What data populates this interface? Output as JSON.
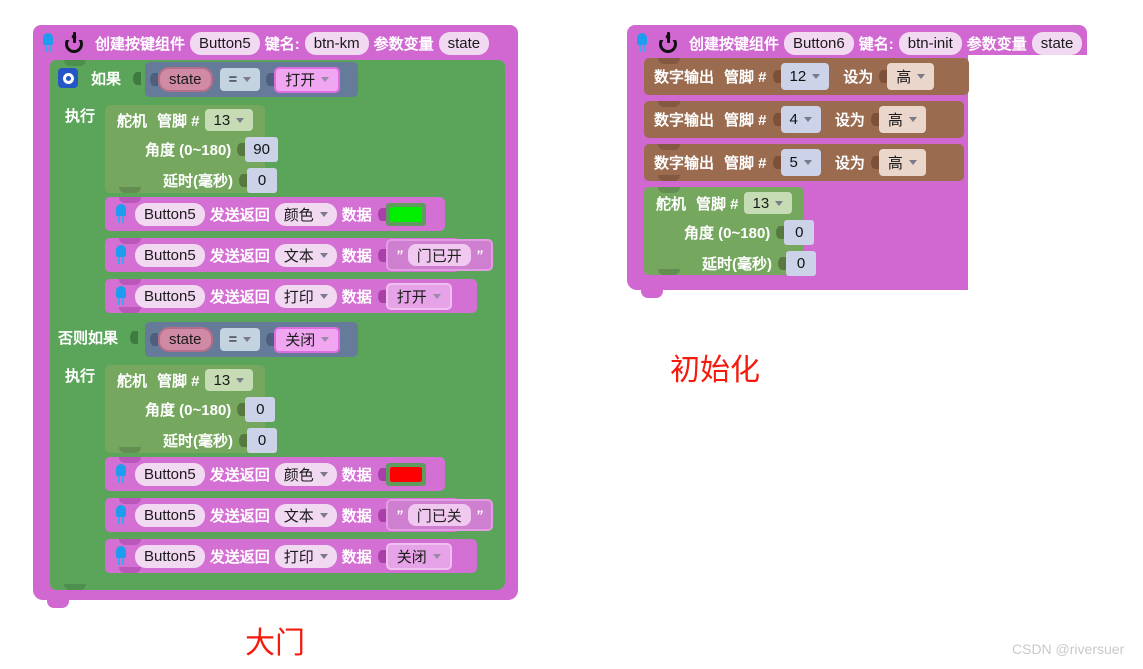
{
  "meta": {
    "watermark": "CSDN @riversuer",
    "captions": {
      "left": "大门",
      "right": "初始化"
    },
    "colors": {
      "event_purple": "#d168d1",
      "control_green": "#5ba55b",
      "servo_olive": "#76a75f",
      "send_magenta": "#d46fd4",
      "logic_blue": "#667a99",
      "digital_brown": "#9a6b4f",
      "caption_red": "#f41b0c",
      "swatch_open": "#00ee00",
      "swatch_close": "#ff0000"
    }
  },
  "left_program": {
    "hat": {
      "icon": "power-icon",
      "led_icon": "led-icon",
      "label": "创建按键组件",
      "component": "Button5",
      "key_label": "键名:",
      "key_value": "btn-km",
      "param_label": "参数变量",
      "param_value": "state"
    },
    "if_block": {
      "gear_icon": "gear-icon",
      "if_label": "如果",
      "do_label": "执行",
      "elseif_label": "否则如果",
      "do_label2": "执行"
    },
    "cond1": {
      "variable": "state",
      "operator": "=",
      "value": "打开"
    },
    "cond2": {
      "variable": "state",
      "operator": "=",
      "value": "关闭"
    },
    "servo1": {
      "title": "舵机",
      "pin_label": "管脚 #",
      "pin": "13",
      "angle_label": "角度 (0~180)",
      "angle": "90",
      "delay_label": "延时(毫秒)",
      "delay": "0"
    },
    "servo2": {
      "title": "舵机",
      "pin_label": "管脚 #",
      "pin": "13",
      "angle_label": "角度 (0~180)",
      "angle": "0",
      "delay_label": "延时(毫秒)",
      "delay": "0"
    },
    "branch_true": [
      {
        "component": "Button5",
        "action": "发送返回",
        "kind": "颜色",
        "data_label": "数据",
        "value_type": "color",
        "value": "#00ee00"
      },
      {
        "component": "Button5",
        "action": "发送返回",
        "kind": "文本",
        "data_label": "数据",
        "value_type": "text",
        "value": "门已开"
      },
      {
        "component": "Button5",
        "action": "发送返回",
        "kind": "打印",
        "data_label": "数据",
        "value_type": "dropdown",
        "value": "打开"
      }
    ],
    "branch_false": [
      {
        "component": "Button5",
        "action": "发送返回",
        "kind": "颜色",
        "data_label": "数据",
        "value_type": "color",
        "value": "#ff0000"
      },
      {
        "component": "Button5",
        "action": "发送返回",
        "kind": "文本",
        "data_label": "数据",
        "value_type": "text",
        "value": "门已关"
      },
      {
        "component": "Button5",
        "action": "发送返回",
        "kind": "打印",
        "data_label": "数据",
        "value_type": "dropdown",
        "value": "关闭"
      }
    ]
  },
  "right_program": {
    "hat": {
      "icon": "power-icon",
      "led_icon": "led-icon",
      "label": "创建按键组件",
      "component": "Button6",
      "key_label": "键名:",
      "key_value": "btn-init",
      "param_label": "参数变量",
      "param_value": "state"
    },
    "digital_outputs": [
      {
        "title": "数字输出",
        "pin_label": "管脚 #",
        "pin": "12",
        "set_label": "设为",
        "level": "高"
      },
      {
        "title": "数字输出",
        "pin_label": "管脚 #",
        "pin": "4",
        "set_label": "设为",
        "level": "高"
      },
      {
        "title": "数字输出",
        "pin_label": "管脚 #",
        "pin": "5",
        "set_label": "设为",
        "level": "高"
      }
    ],
    "servo": {
      "title": "舵机",
      "pin_label": "管脚 #",
      "pin": "13",
      "angle_label": "角度 (0~180)",
      "angle": "0",
      "delay_label": "延时(毫秒)",
      "delay": "0"
    }
  }
}
